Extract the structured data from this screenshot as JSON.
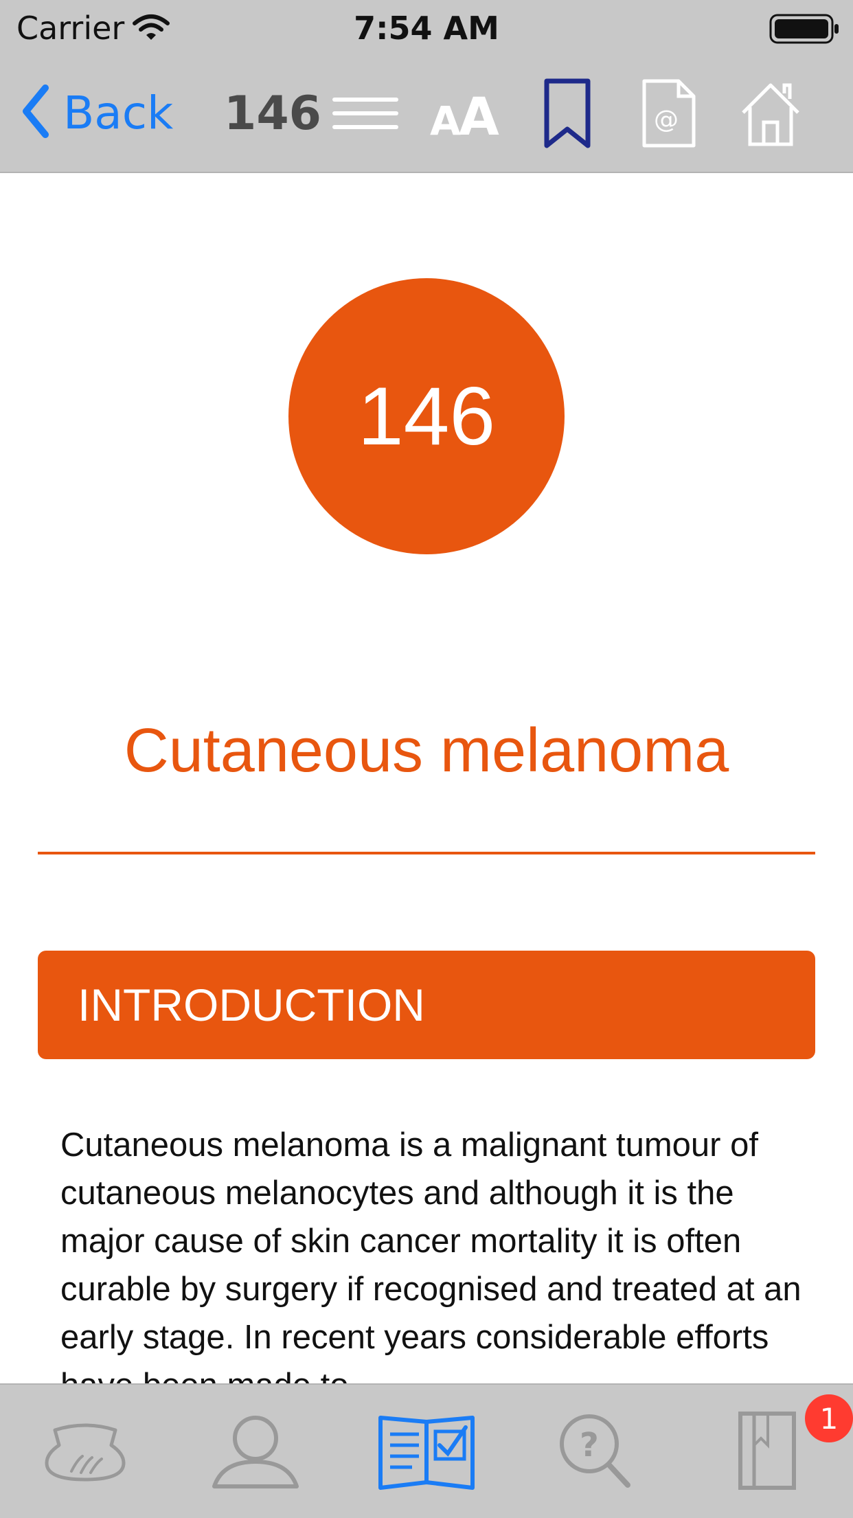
{
  "status_bar": {
    "carrier": "Carrier",
    "time": "7:54 AM"
  },
  "nav_bar": {
    "back_label": "Back",
    "page_number": "146",
    "icons": [
      "menu-icon",
      "font-size-icon",
      "bookmark-icon",
      "email-icon",
      "home-icon"
    ]
  },
  "content": {
    "chapter_number": "146",
    "chapter_title": "Cutaneous melanoma",
    "section_header": "INTRODUCTION",
    "body_text": "Cutaneous melanoma is a malignant tumour of cutaneous melanocytes and although it is the major cause of skin cancer mortality it is often curable by surgery if recognised and treated at an early stage. In recent years considerable efforts have been made to"
  },
  "tab_bar": {
    "tabs": [
      "skin-icon",
      "profile-icon",
      "book-checklist-icon",
      "search-help-icon",
      "notebook-icon"
    ],
    "active_tab": "book-checklist-icon",
    "badge_count": "1"
  },
  "colors": {
    "accent": "#e8560f",
    "link": "#1a7cf5",
    "bookmark": "#1e2a8a",
    "bar": "#c8c8c8"
  }
}
